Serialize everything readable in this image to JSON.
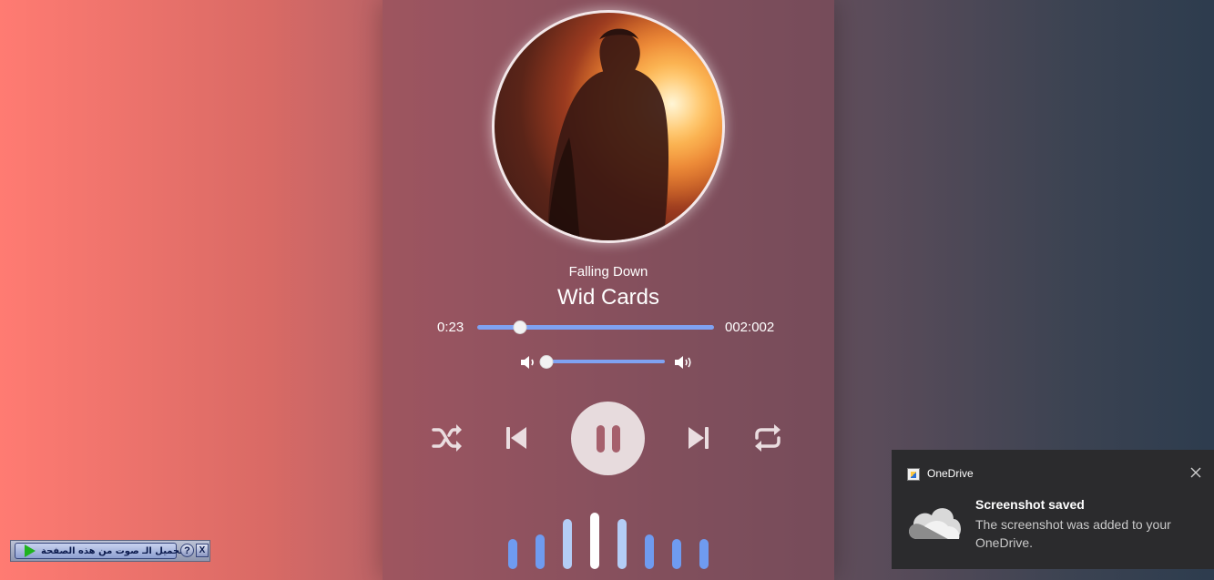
{
  "player": {
    "song_title": "Falling Down",
    "artist": "Wid Cards",
    "current_time": "0:23",
    "duration": "002:002",
    "progress": 0.18,
    "volume": 0.0,
    "state": "playing",
    "accent_color": "#7fa2f2",
    "controls": [
      "shuffle-icon",
      "previous-icon",
      "pause-icon",
      "next-icon",
      "repeat-icon"
    ],
    "visualizer": {
      "levels": [
        0.35,
        0.45,
        0.85,
        1.0,
        0.85,
        0.45,
        0.35,
        0.35
      ],
      "colors": [
        "#6f9bf0",
        "#6f9bf0",
        "#b4cdf6",
        "#ffffff",
        "#b4cdf6",
        "#6f9bf0",
        "#6f9bf0",
        "#6f9bf0"
      ]
    }
  },
  "notification": {
    "app_name": "OneDrive",
    "heading": "Screenshot saved",
    "body": "The screenshot was added to your OneDrive."
  },
  "download_bar": {
    "label": "تحميل الـ صوت من هذه الصفحة",
    "help": "?",
    "close": "X"
  }
}
